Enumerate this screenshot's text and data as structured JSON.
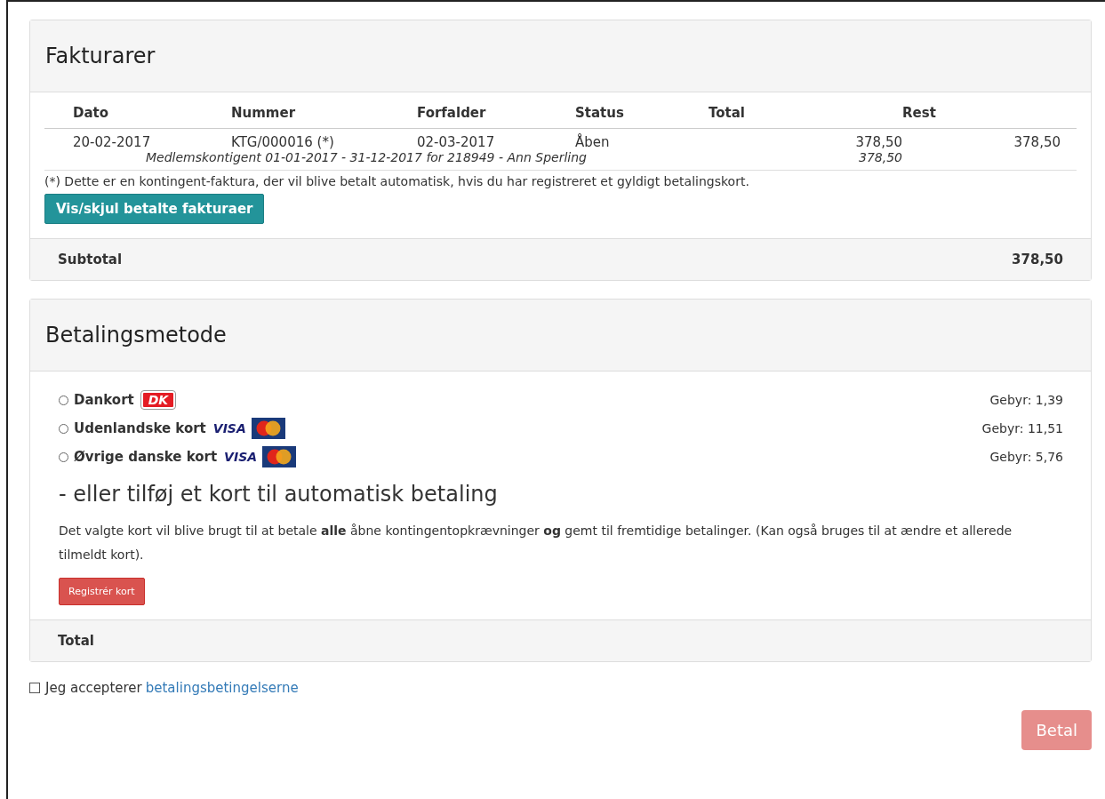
{
  "invoices": {
    "title": "Fakturarer",
    "columns": [
      "Dato",
      "Nummer",
      "Forfalder",
      "Status",
      "Total",
      "Rest"
    ],
    "rows": [
      {
        "date": "20-02-2017",
        "number": "KTG/000016 (*)",
        "due": "02-03-2017",
        "status": "Åben",
        "total": "378,50",
        "rest": "378,50",
        "line_description": "Medlemskontigent 01-01-2017 - 31-12-2017 for 218949 - Ann Sperling",
        "line_amount": "378,50"
      }
    ],
    "footnote": "(*) Dette er en kontingent-faktura, der vil blive betalt automatisk, hvis du har registreret et gyldigt betalingskort.",
    "toggle_button": "Vis/skjul betalte fakturaer",
    "subtotal_label": "Subtotal",
    "subtotal_value": "378,50"
  },
  "payment": {
    "title": "Betalingsmetode",
    "methods": [
      {
        "label": "Dankort",
        "selected": false,
        "logos": [
          {
            "kind": "dk",
            "text": "DK"
          }
        ],
        "fee": "Gebyr: 1,39"
      },
      {
        "label": "Udenlandske kort",
        "selected": false,
        "logos": [
          {
            "kind": "visa",
            "text": "VISA"
          },
          {
            "kind": "mastercard"
          }
        ],
        "fee": "Gebyr: 11,51"
      },
      {
        "label": "Øvrige danske kort",
        "selected": false,
        "logos": [
          {
            "kind": "visa",
            "text": "VISA"
          },
          {
            "kind": "mastercard"
          }
        ],
        "fee": "Gebyr: 5,76"
      }
    ],
    "auto_heading": "- eller tilføj et kort til automatisk betaling",
    "auto_text": "Det valgte kort vil blive brugt til at betale **alle** åbne kontingentopkrævninger **og** gemt til fremtidige betalinger. (Kan også bruges til at ændre et allerede tilmeldt kort).",
    "register_button": "Registrér kort",
    "total_label": "Total"
  },
  "terms": {
    "checked": false,
    "text": "Jeg accepterer",
    "link": "betalingsbetingelserne"
  },
  "pay_button": {
    "label": "Betal",
    "disabled": true
  }
}
